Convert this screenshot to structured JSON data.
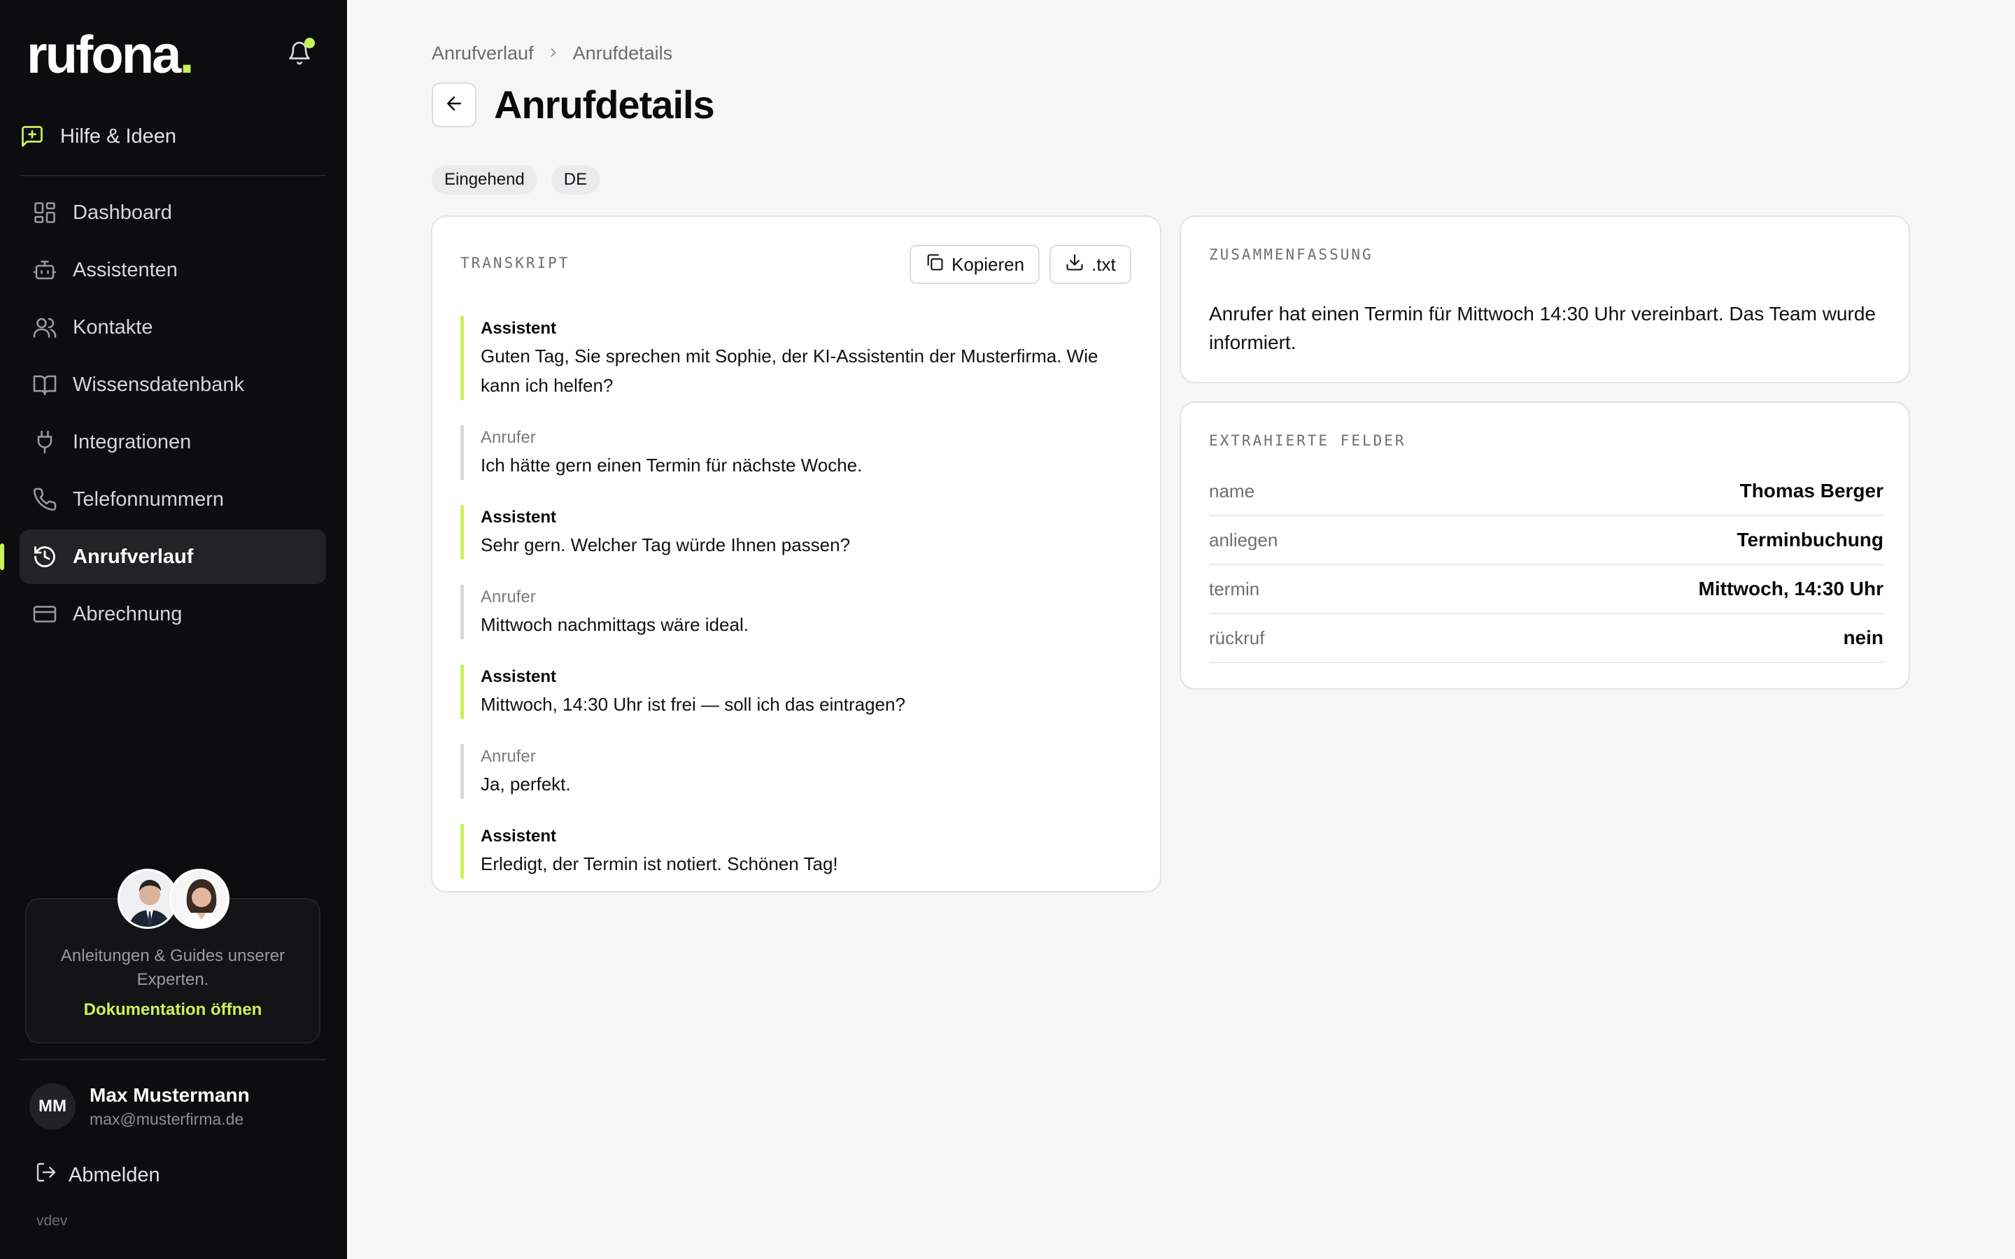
{
  "sidebar": {
    "logo": "rufona",
    "logo_dot": ".",
    "help_label": "Hilfe & Ideen",
    "nav": [
      {
        "label": "Dashboard",
        "icon": "dashboard-icon"
      },
      {
        "label": "Assistenten",
        "icon": "bot-icon"
      },
      {
        "label": "Kontakte",
        "icon": "users-icon"
      },
      {
        "label": "Wissensdatenbank",
        "icon": "book-icon"
      },
      {
        "label": "Integrationen",
        "icon": "plug-icon"
      },
      {
        "label": "Telefonnummern",
        "icon": "phone-icon"
      },
      {
        "label": "Anrufverlauf",
        "icon": "history-icon",
        "active": true
      },
      {
        "label": "Abrechnung",
        "icon": "credit-card-icon"
      }
    ],
    "docs_card": {
      "text": "Anleitungen & Guides unserer Experten.",
      "link": "Dokumentation öffnen"
    },
    "user": {
      "initials": "MM",
      "name": "Max Mustermann",
      "email": "max@musterfirma.de"
    },
    "logout_label": "Abmelden",
    "version": "vdev"
  },
  "breadcrumb": {
    "parent": "Anrufverlauf",
    "current": "Anrufdetails"
  },
  "page_title": "Anrufdetails",
  "tags": [
    "Eingehend",
    "DE"
  ],
  "transcript": {
    "label": "Transkript",
    "copy_label": "Kopieren",
    "download_label": ".txt",
    "messages": [
      {
        "role": "Assistent",
        "text": "Guten Tag, Sie sprechen mit Sophie, der KI-Assistentin der Musterfirma. Wie kann ich helfen?"
      },
      {
        "role": "Anrufer",
        "text": "Ich hätte gern einen Termin für nächste Woche."
      },
      {
        "role": "Assistent",
        "text": "Sehr gern. Welcher Tag würde Ihnen passen?"
      },
      {
        "role": "Anrufer",
        "text": "Mittwoch nachmittags wäre ideal."
      },
      {
        "role": "Assistent",
        "text": "Mittwoch, 14:30 Uhr ist frei — soll ich das eintragen?"
      },
      {
        "role": "Anrufer",
        "text": "Ja, perfekt."
      },
      {
        "role": "Assistent",
        "text": "Erledigt, der Termin ist notiert. Schönen Tag!"
      }
    ]
  },
  "summary": {
    "label": "Zusammenfassung",
    "text": "Anrufer hat einen Termin für Mittwoch 14:30 Uhr vereinbart. Das Team wurde informiert."
  },
  "fields": {
    "label": "Extrahierte Felder",
    "rows": [
      {
        "key": "name",
        "value": "Thomas Berger"
      },
      {
        "key": "anliegen",
        "value": "Terminbuchung"
      },
      {
        "key": "termin",
        "value": "Mittwoch, 14:30 Uhr"
      },
      {
        "key": "rückruf",
        "value": "nein"
      }
    ]
  },
  "colors": {
    "accent": "#c9f25a",
    "sidebar_bg": "#0d0d0f",
    "page_bg": "#f6f6f6"
  }
}
